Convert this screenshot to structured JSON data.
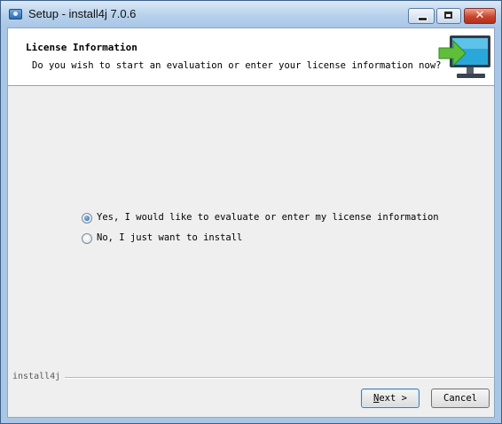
{
  "window": {
    "title": "Setup - install4j 7.0.6",
    "close_glyph": "✕",
    "icon": "app-window-icon"
  },
  "header": {
    "title": "License Information",
    "subtitle": "Do you wish to start an evaluation or enter your license information now?",
    "image": "monitor-with-arrow-icon"
  },
  "options": [
    {
      "label": "Yes, I would like to evaluate or enter my license information",
      "selected": true
    },
    {
      "label": "No, I just want to install",
      "selected": false
    }
  ],
  "footer": {
    "brand": "install4j",
    "next": {
      "mnemonic": "N",
      "rest": "ext >"
    },
    "cancel": "Cancel"
  },
  "colors": {
    "titlebar": "#b7d1ec",
    "panel": "#efefef",
    "header": "#ffffff",
    "arrow": "#5fbf3a"
  }
}
